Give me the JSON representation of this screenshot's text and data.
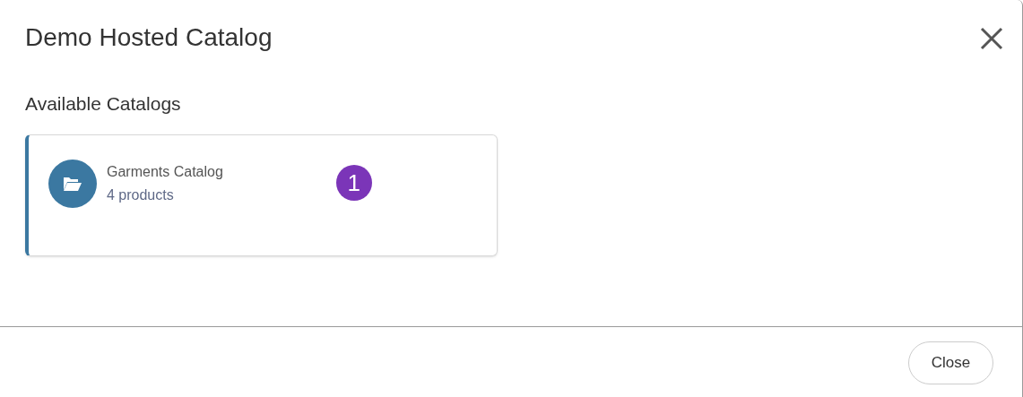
{
  "dialog": {
    "title": "Demo Hosted Catalog"
  },
  "section": {
    "heading": "Available Catalogs"
  },
  "catalogs": [
    {
      "name": "Garments Catalog",
      "count": "4 products",
      "badge": "1"
    }
  ],
  "footer": {
    "buttons": [
      "Close"
    ]
  }
}
